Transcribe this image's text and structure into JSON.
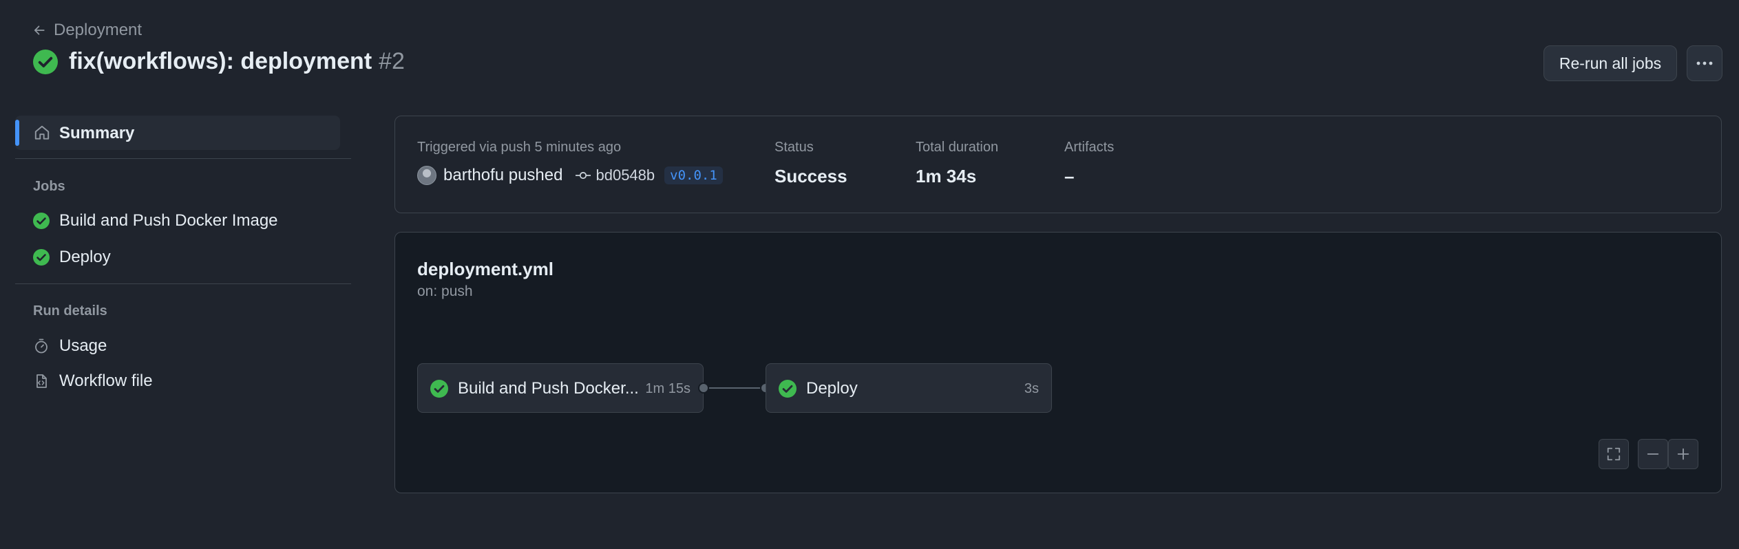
{
  "colors": {
    "success": "#3fb950",
    "accent": "#4493f8",
    "background": "#1f242d"
  },
  "header": {
    "back_label": "Deployment",
    "title": "fix(workflows): deployment",
    "run_number": "#2",
    "rerun_label": "Re-run all jobs",
    "more_icon": "kebab-horizontal-icon"
  },
  "sidebar": {
    "summary_label": "Summary",
    "jobs_heading": "Jobs",
    "jobs": [
      {
        "label": "Build and Push Docker Image",
        "status": "success"
      },
      {
        "label": "Deploy",
        "status": "success"
      }
    ],
    "run_details_heading": "Run details",
    "run_details": [
      {
        "label": "Usage",
        "icon": "stopwatch-icon"
      },
      {
        "label": "Workflow file",
        "icon": "file-code-icon"
      }
    ]
  },
  "summary": {
    "trigger_text": "Triggered via push 5 minutes ago",
    "actor": "barthofu pushed",
    "commit_sha": "bd0548b",
    "tag": "v0.0.1",
    "status_label": "Status",
    "status_value": "Success",
    "duration_label": "Total duration",
    "duration_value": "1m 34s",
    "artifacts_label": "Artifacts",
    "artifacts_value": "–"
  },
  "graph": {
    "workflow_file": "deployment.yml",
    "trigger": "on: push",
    "jobs": [
      {
        "name": "Build and Push Docker...",
        "duration": "1m 15s",
        "status": "success"
      },
      {
        "name": "Deploy",
        "duration": "3s",
        "status": "success"
      }
    ],
    "controls": [
      "fullscreen-icon",
      "zoom-out-icon",
      "zoom-in-icon"
    ]
  }
}
